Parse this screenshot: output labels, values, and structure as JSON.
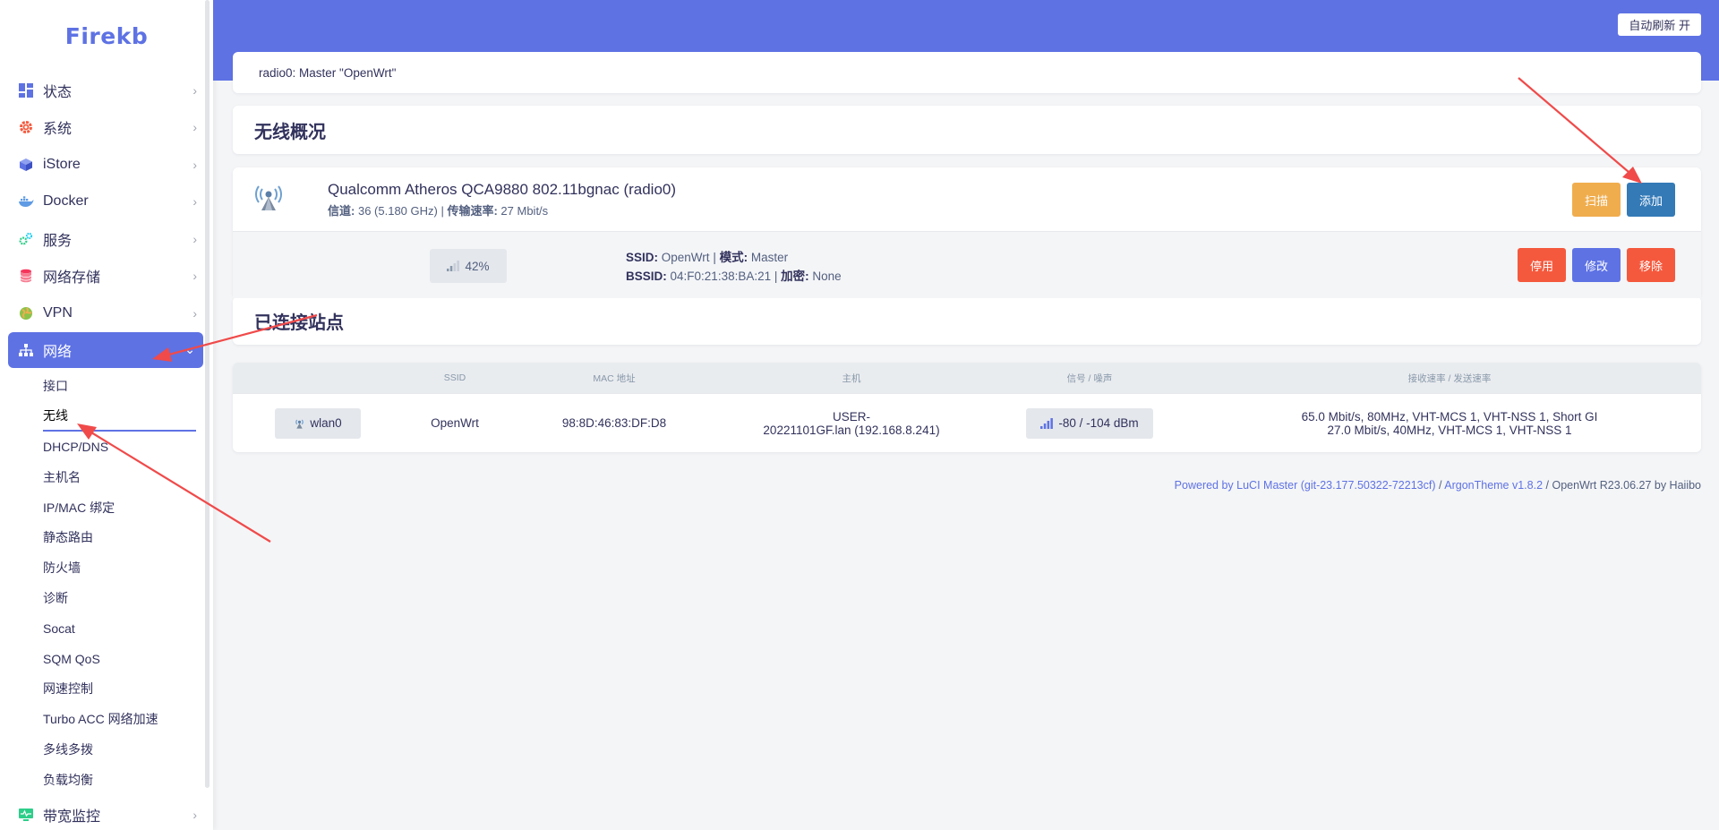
{
  "app": {
    "logo": "Firekb"
  },
  "sidebar": {
    "items": [
      {
        "label": "状态",
        "icon": "dashboard-icon",
        "color": "#5e72e4"
      },
      {
        "label": "系统",
        "icon": "gear-icon",
        "color": "#f5593d"
      },
      {
        "label": "iStore",
        "icon": "cube-icon",
        "color": "#5e72e4"
      },
      {
        "label": "Docker",
        "icon": "docker-icon",
        "color": "#5e9be4"
      },
      {
        "label": "服务",
        "icon": "cogs-icon",
        "color": "#2dce89"
      },
      {
        "label": "网络存储",
        "icon": "database-icon",
        "color": "#f5365c"
      },
      {
        "label": "VPN",
        "icon": "globe-icon",
        "color": "#8bc34a"
      },
      {
        "label": "网络",
        "icon": "network-icon",
        "color": "#ffffff"
      }
    ],
    "network_submenu": [
      "接口",
      "无线",
      "DHCP/DNS",
      "主机名",
      "IP/MAC 绑定",
      "静态路由",
      "防火墙",
      "诊断",
      "Socat",
      "SQM QoS",
      "网速控制",
      "Turbo ACC 网络加速",
      "多线多拨",
      "负载均衡"
    ],
    "bottom_item": {
      "label": "带宽监控",
      "icon": "monitor-icon",
      "color": "#2dce89"
    }
  },
  "header": {
    "auto_refresh": "自动刷新 开"
  },
  "breadcrumb": "radio0: Master \"OpenWrt\"",
  "wireless_overview": {
    "title": "无线概况",
    "radio": {
      "name": "Qualcomm Atheros QCA9880 802.11bgnac (radio0)",
      "channel_label": "信道:",
      "channel_value": "36 (5.180 GHz)",
      "rate_label": "传输速率:",
      "rate_value": "27 Mbit/s",
      "scan_button": "扫描",
      "add_button": "添加"
    },
    "network": {
      "signal_percent": "42%",
      "ssid_label": "SSID:",
      "ssid_value": "OpenWrt",
      "mode_label": "模式:",
      "mode_value": "Master",
      "bssid_label": "BSSID:",
      "bssid_value": "04:F0:21:38:BA:21",
      "enc_label": "加密:",
      "enc_value": "None",
      "disable_button": "停用",
      "edit_button": "修改",
      "remove_button": "移除"
    }
  },
  "stations": {
    "title": "已连接站点",
    "columns": [
      "",
      "SSID",
      "MAC 地址",
      "主机",
      "信号 / 噪声",
      "接收速率 / 发送速率"
    ],
    "rows": [
      {
        "iface": "wlan0",
        "ssid": "OpenWrt",
        "mac": "98:8D:46:83:DF:D8",
        "host_line1": "USER-",
        "host_line2": "20221101GF.lan (192.168.8.241)",
        "signal": "-80 / -104 dBm",
        "rx": "65.0 Mbit/s, 80MHz, VHT-MCS 1, VHT-NSS 1, Short GI",
        "tx": "27.0 Mbit/s, 40MHz, VHT-MCS 1, VHT-NSS 1"
      }
    ]
  },
  "footer": {
    "luci": "Powered by LuCI Master (git-23.177.50322-72213cf)",
    "sep": " / ",
    "theme": "ArgonTheme v1.8.2",
    "rest": " / OpenWrt R23.06.27 by Haiibo"
  }
}
